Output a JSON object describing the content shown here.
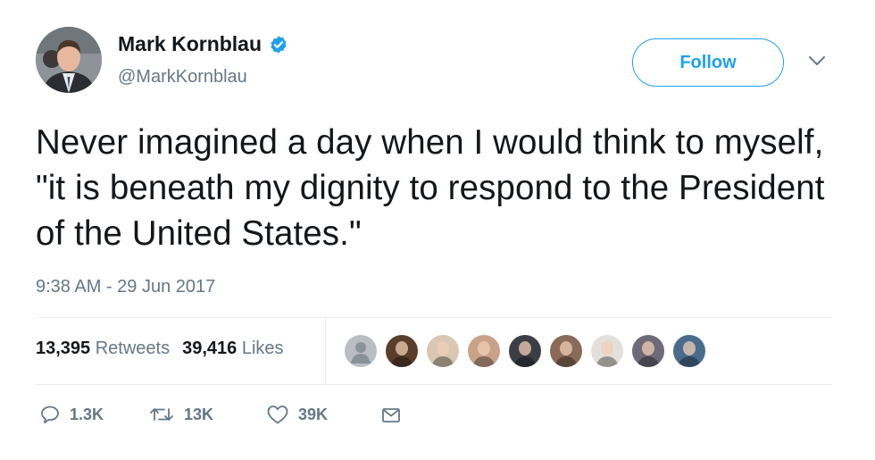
{
  "author": {
    "name": "Mark Kornblau",
    "handle": "@MarkKornblau",
    "verified": true
  },
  "follow_button": {
    "label": "Follow"
  },
  "tweet": {
    "text": "Never imagined a day when I would think to myself, \"it is beneath my dignity to respond to the President of the United States.\"",
    "timestamp": "9:38 AM - 29 Jun 2017"
  },
  "stats": {
    "retweets_count": "13,395",
    "retweets_label": "Retweets",
    "likes_count": "39,416",
    "likes_label": "Likes"
  },
  "likers": [
    {
      "color": "#b8bec4",
      "default": true
    },
    {
      "color": "#5a3e2b"
    },
    {
      "color": "#d9c7b3"
    },
    {
      "color": "#c9a28a"
    },
    {
      "color": "#3b3f45"
    },
    {
      "color": "#8a6a58"
    },
    {
      "color": "#e3e0dc"
    },
    {
      "color": "#6e6a78"
    },
    {
      "color": "#4a6c8c"
    }
  ],
  "actions": {
    "reply_count": "1.3K",
    "retweet_count": "13K",
    "like_count": "39K"
  },
  "colors": {
    "accent": "#1da1f2",
    "text_primary": "#14171a",
    "text_secondary": "#657786",
    "divider": "#e6ecf0"
  },
  "icons": [
    "verified-icon",
    "chevron-down-icon",
    "reply-icon",
    "retweet-icon",
    "heart-icon",
    "message-icon"
  ]
}
